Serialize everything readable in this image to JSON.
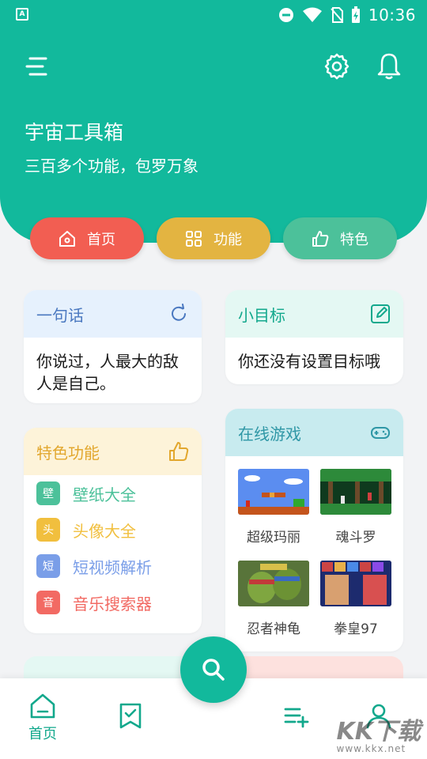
{
  "status_bar": {
    "time": "10:36",
    "app_icon_letter": "A"
  },
  "header": {
    "title": "宇宙工具箱",
    "subtitle": "三百多个功能，包罗万象"
  },
  "pills": {
    "home": "首页",
    "functions": "功能",
    "special": "特色"
  },
  "quote_card": {
    "title": "一句话",
    "text": "你说过，人最大的敌人是自己。"
  },
  "goal_card": {
    "title": "小目标",
    "text": "你还没有设置目标哦"
  },
  "features_card": {
    "title": "特色功能",
    "items": [
      {
        "badge": "壁",
        "label": "壁纸大全",
        "color": "#4cc19a"
      },
      {
        "badge": "头",
        "label": "头像大全",
        "color": "#f1bf3e"
      },
      {
        "badge": "短",
        "label": "短视频解析",
        "color": "#7a9ee8"
      },
      {
        "badge": "音",
        "label": "音乐搜索器",
        "color": "#f26a63"
      }
    ]
  },
  "games_card": {
    "title": "在线游戏",
    "games": [
      {
        "name": "超级玛丽"
      },
      {
        "name": "魂斗罗"
      },
      {
        "name": "忍者神龟"
      },
      {
        "name": "拳皇97"
      }
    ]
  },
  "bottom_nav": {
    "home_label": "首页"
  },
  "watermark": {
    "text": "KK下载",
    "url": "www.kkx.net"
  },
  "colors": {
    "primary": "#12b99c",
    "home_pill": "#f25e52",
    "func_pill": "#e3b441",
    "special_pill": "#4cc19a"
  }
}
